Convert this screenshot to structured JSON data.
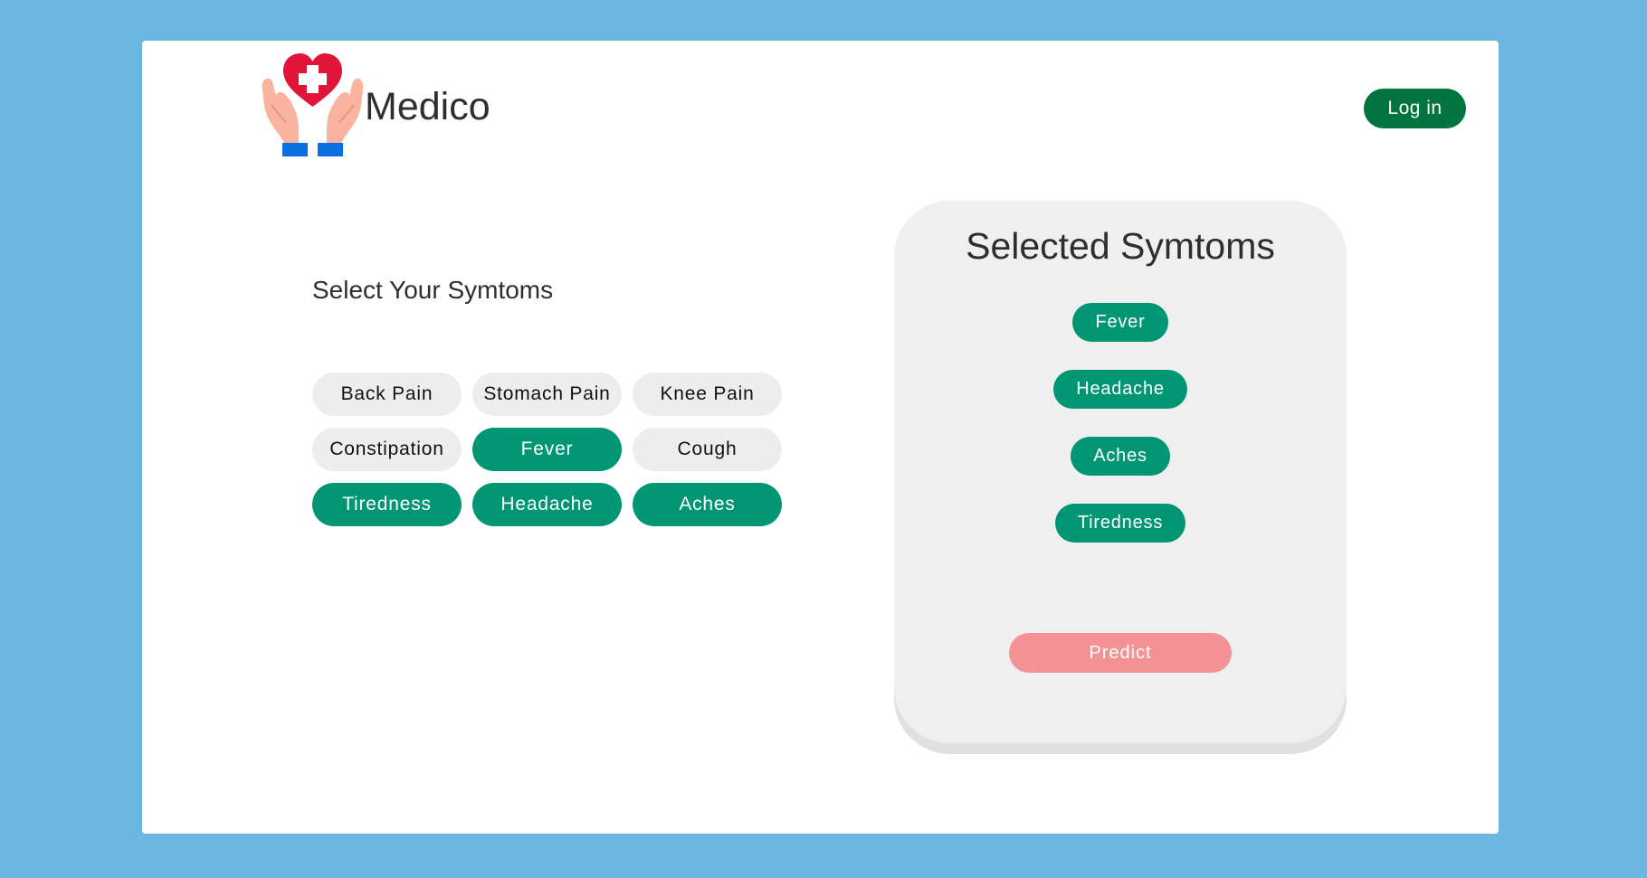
{
  "header": {
    "brand": "Medico",
    "login_label": "Log in"
  },
  "picker": {
    "title": "Select Your Symtoms",
    "symptoms": [
      {
        "label": "Back Pain",
        "selected": false
      },
      {
        "label": "Stomach Pain",
        "selected": false
      },
      {
        "label": "Knee Pain",
        "selected": false
      },
      {
        "label": "Constipation",
        "selected": false
      },
      {
        "label": "Fever",
        "selected": true
      },
      {
        "label": "Cough",
        "selected": false
      },
      {
        "label": "Tiredness",
        "selected": true
      },
      {
        "label": "Headache",
        "selected": true
      },
      {
        "label": "Aches",
        "selected": true
      }
    ]
  },
  "selected_panel": {
    "title": "Selected Symtoms",
    "items": [
      "Fever",
      "Headache",
      "Aches",
      "Tiredness"
    ],
    "predict_label": "Predict"
  },
  "colors": {
    "background": "#6cb7e2",
    "accent_green": "#009674",
    "login_green": "#01743f",
    "predict_pink": "#f39396"
  },
  "icons": {
    "logo": "heart-with-cross-in-hands-icon"
  }
}
